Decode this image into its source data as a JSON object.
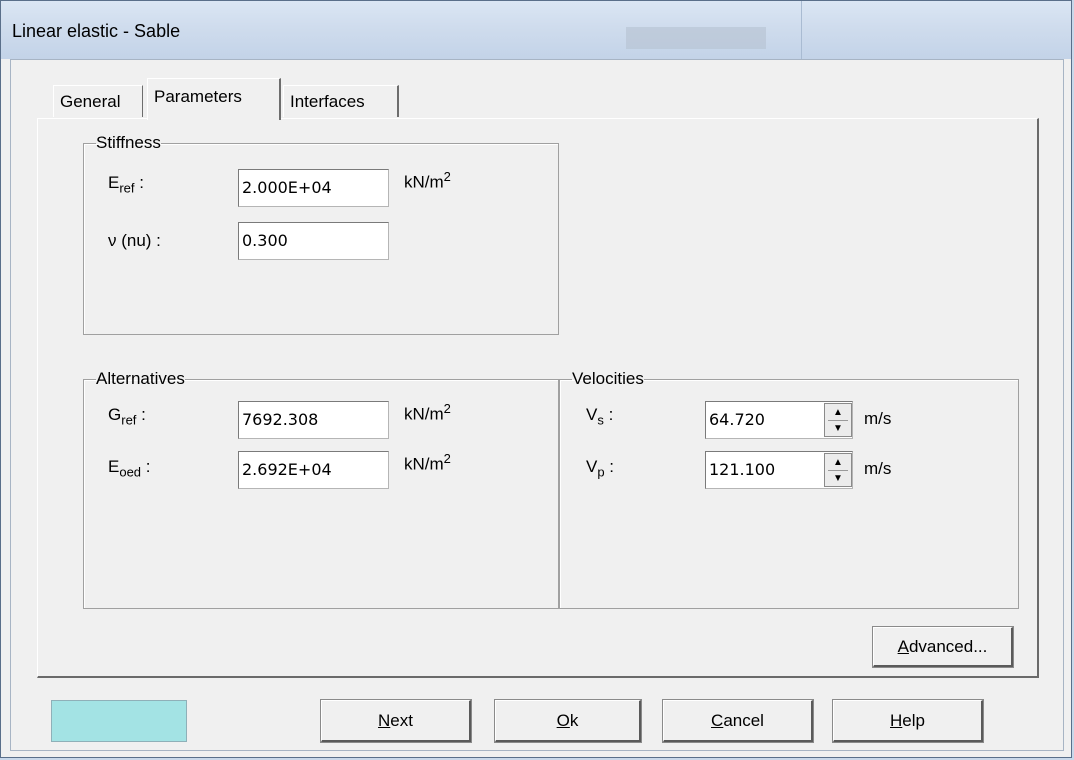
{
  "window": {
    "title": "Linear elastic - Sable"
  },
  "tabs": [
    {
      "label": "General"
    },
    {
      "label": "Parameters"
    },
    {
      "label": "Interfaces"
    }
  ],
  "stiffness": {
    "legend": "Stiffness",
    "e_ref": {
      "label_main": "E",
      "label_sub": "ref",
      "label_colon": " :",
      "value": "2.000E+04",
      "unit_main": "kN/m",
      "unit_sup": "2"
    },
    "nu": {
      "label": "ν (nu) :",
      "value": "0.300"
    }
  },
  "alternatives": {
    "legend": "Alternatives",
    "g_ref": {
      "label_main": "G",
      "label_sub": "ref",
      "label_colon": " :",
      "value": "7692.308",
      "unit_main": "kN/m",
      "unit_sup": "2"
    },
    "e_oed": {
      "label_main": "E",
      "label_sub": "oed",
      "label_colon": " :",
      "value": "2.692E+04",
      "unit_main": "kN/m",
      "unit_sup": "2"
    }
  },
  "velocities": {
    "legend": "Velocities",
    "vs": {
      "label_main": "V",
      "label_sub": "s",
      "label_colon": " :",
      "value": "64.720",
      "unit": "m/s"
    },
    "vp": {
      "label_main": "V",
      "label_sub": "p",
      "label_colon": " :",
      "value": "121.100",
      "unit": "m/s"
    }
  },
  "buttons": {
    "advanced": {
      "mnemonic": "A",
      "rest": "dvanced..."
    },
    "next": {
      "mnemonic": "N",
      "rest": "ext"
    },
    "ok": {
      "mnemonic": "O",
      "rest": "k"
    },
    "cancel": {
      "mnemonic": "C",
      "rest": "ancel"
    },
    "help": {
      "mnemonic": "H",
      "rest": "elp"
    }
  },
  "colors": {
    "swatch": "#a3e3e4"
  },
  "icons": {
    "spin_up": "arrow-up-icon",
    "spin_down": "arrow-down-icon"
  }
}
